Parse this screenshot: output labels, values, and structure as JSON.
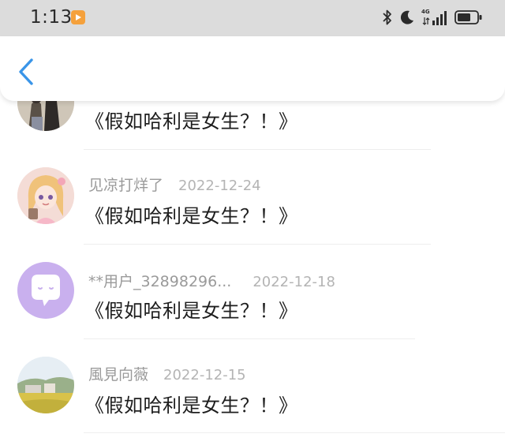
{
  "status_bar": {
    "time": "1:13",
    "network_label": "4G",
    "icons": [
      "video-app-icon",
      "bluetooth-icon",
      "moon-icon",
      "signal-icon",
      "battery-icon"
    ]
  },
  "nav": {
    "back_icon": "chevron-left-icon",
    "accent_color": "#3a95e8"
  },
  "comments": [
    {
      "username": "",
      "date": "",
      "text": "《假如哈利是女生？！》",
      "avatar": "photo-couple"
    },
    {
      "username": "见凉打烊了",
      "date": "2022-12-24",
      "text": "《假如哈利是女生？！》",
      "avatar": "anime-girl"
    },
    {
      "username": "**用户_32898296...",
      "date": "2022-12-18",
      "text": "《假如哈利是女生？！》",
      "avatar": "chat-bubble-purple"
    },
    {
      "username": "風見向薇",
      "date": "2022-12-15",
      "text": "《假如哈利是女生？！》",
      "avatar": "landscape-photo"
    }
  ]
}
